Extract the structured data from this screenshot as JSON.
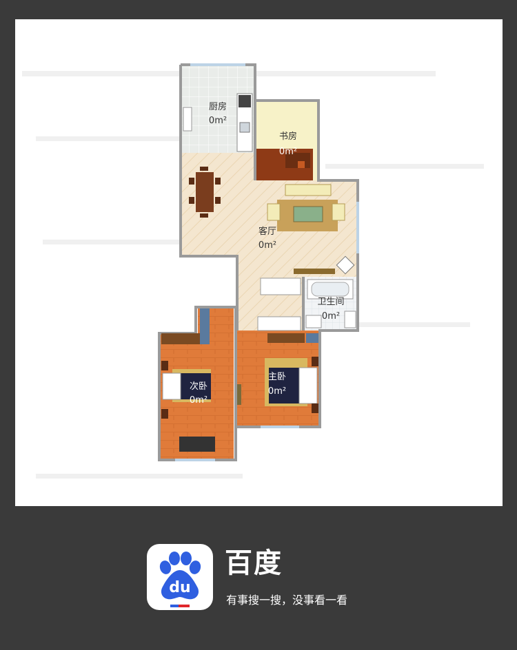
{
  "floor_plan": {
    "rooms": {
      "kitchen": {
        "name": "厨房",
        "area": "0m²"
      },
      "study": {
        "name": "书房",
        "area": "0m²"
      },
      "living": {
        "name": "客厅",
        "area": "0m²"
      },
      "bathroom": {
        "name": "卫生间",
        "area": "0m²"
      },
      "second_bedroom": {
        "name": "次卧",
        "area": "0m²"
      },
      "master_bedroom": {
        "name": "主卧",
        "area": "0m²"
      }
    }
  },
  "brand": {
    "name": "百度",
    "slogan": "有事搜一搜，没事看一看",
    "logo_text": "du",
    "colors": {
      "blue": "#2f5fe0",
      "red": "#e0262b",
      "background": "#3a3a3a"
    }
  }
}
